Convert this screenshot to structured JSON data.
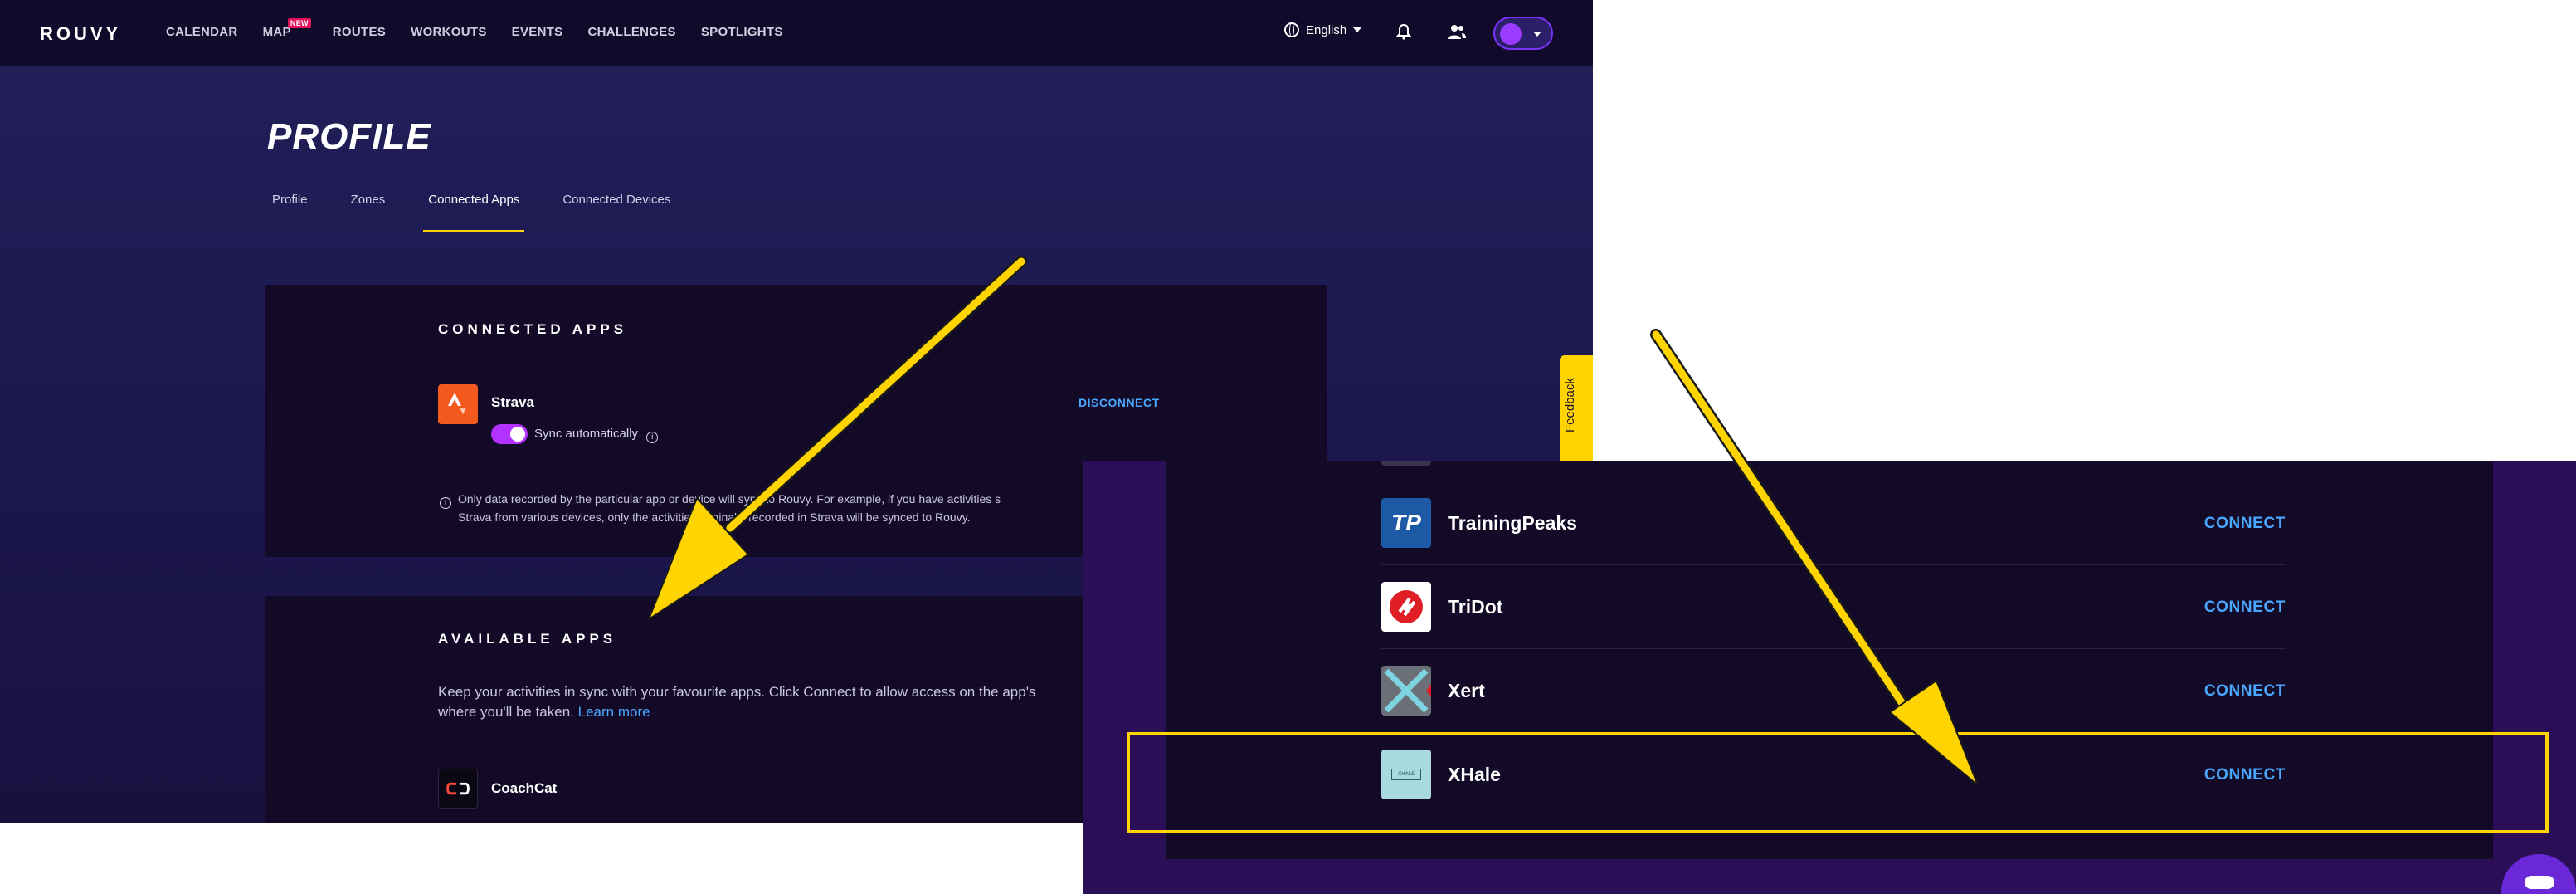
{
  "header": {
    "logo": "ROUVY",
    "nav": [
      {
        "label": "CALENDAR",
        "badge": ""
      },
      {
        "label": "MAP",
        "badge": "NEW"
      },
      {
        "label": "ROUTES",
        "badge": ""
      },
      {
        "label": "WORKOUTS",
        "badge": ""
      },
      {
        "label": "EVENTS",
        "badge": ""
      },
      {
        "label": "CHALLENGES",
        "badge": ""
      },
      {
        "label": "SPOTLIGHTS",
        "badge": ""
      }
    ],
    "language": "English"
  },
  "page": {
    "title": "PROFILE",
    "tabs": [
      "Profile",
      "Zones",
      "Connected Apps",
      "Connected Devices"
    ],
    "active_tab": "Connected Apps"
  },
  "connected": {
    "heading": "CONNECTED APPS",
    "app_name": "Strava",
    "sync_label": "Sync automatically",
    "action": "DISCONNECT",
    "note_line1": "Only data recorded by the particular app or device will sync to Rouvy. For example, if you have activities s",
    "note_line2": "Strava from various devices, only the activities originally recorded in Strava will be synced to Rouvy."
  },
  "available": {
    "heading": "AVAILABLE APPS",
    "desc_line1": "Keep your activities in sync with your favourite apps. Click Connect to allow access on the app's",
    "desc_line2": "where you'll be taken.",
    "learn_more": "Learn more",
    "first_app": "CoachCat"
  },
  "feedback": "Feedback",
  "zoomed_apps": [
    {
      "name": "TrainingPeaks",
      "action": "CONNECT",
      "tile_text": "TP"
    },
    {
      "name": "TriDot",
      "action": "CONNECT"
    },
    {
      "name": "Xert",
      "action": "CONNECT"
    },
    {
      "name": "XHale",
      "action": "CONNECT",
      "tile_text": "XHALE"
    }
  ],
  "colors": {
    "accent_yellow": "#ffd400",
    "link_blue": "#4aa7ff",
    "toggle_purple": "#b332ff",
    "strava_orange": "#f45a1e"
  }
}
